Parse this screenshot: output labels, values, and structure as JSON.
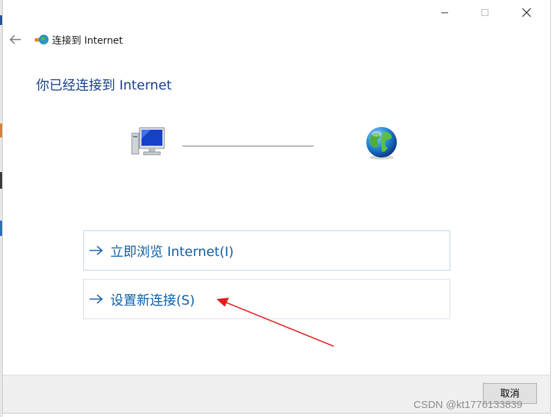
{
  "window": {
    "title": "连接到 Internet",
    "controls": {
      "minimize_icon": "minimize-icon",
      "maximize_icon": "maximize-icon",
      "close_icon": "close-icon"
    }
  },
  "nav": {
    "back_icon": "back-arrow-icon",
    "wizard_icon": "network-connection-icon"
  },
  "heading": "你已经连接到 Internet",
  "diagram": {
    "computer_icon": "computer-icon",
    "internet_icon": "globe-icon"
  },
  "commands": [
    {
      "label": "立即浏览 Internet(I)",
      "icon": "right-arrow-icon"
    },
    {
      "label": "设置新连接(S)",
      "icon": "right-arrow-icon"
    }
  ],
  "footer": {
    "cancel_label": "取消"
  },
  "annotation": {
    "color": "#e21b1b"
  },
  "watermark": "CSDN @kt1776133839",
  "colors": {
    "heading": "#1a3f8f",
    "command_text": "#0e5fa8",
    "footer_bg": "#f0f0f0"
  }
}
